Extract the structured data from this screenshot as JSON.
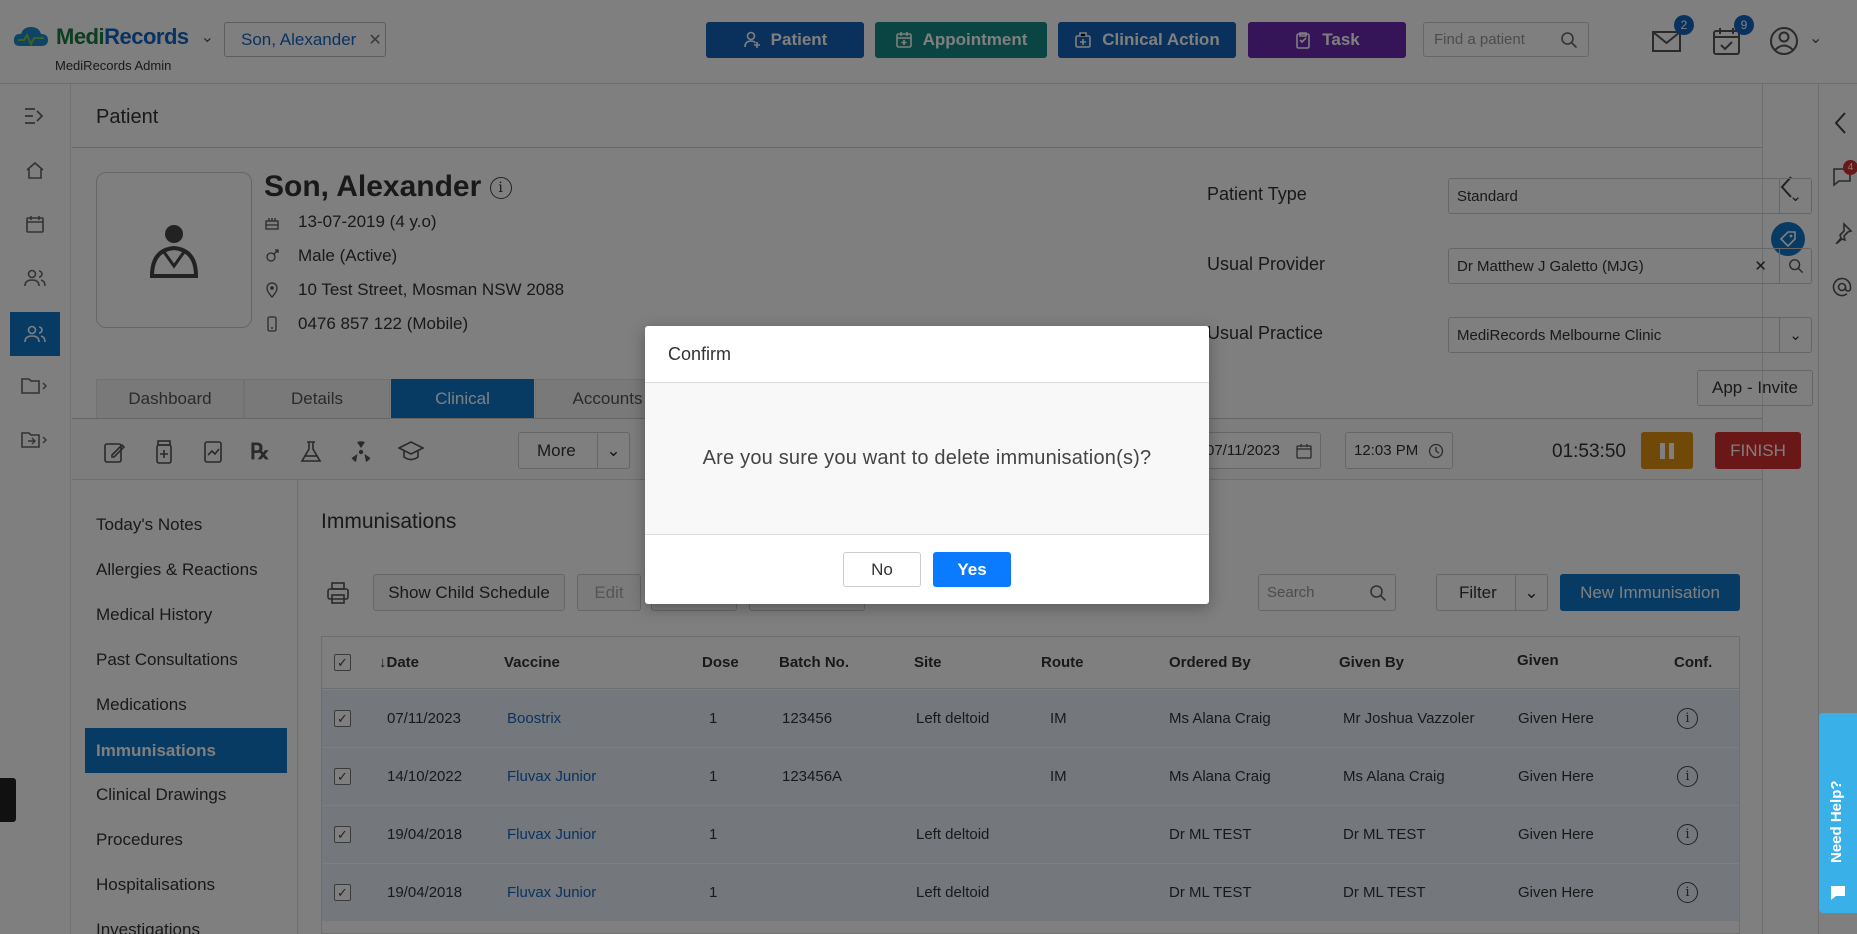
{
  "header": {
    "logo_medi": "Medi",
    "logo_records": "Records",
    "logo_sub": "MediRecords Admin",
    "patient_chip": "Son, Alexander",
    "buttons": {
      "patient": "Patient",
      "appointment": "Appointment",
      "clinical_action": "Clinical Action",
      "task": "Task"
    },
    "find_placeholder": "Find a patient",
    "mail_count": "2",
    "tasks_count": "9"
  },
  "page_title": "Patient",
  "patient": {
    "name": "Son, Alexander",
    "dob": "13-07-2019 (4 y.o)",
    "gender": "Male (Active)",
    "address": "10 Test Street, Mosman NSW 2088",
    "phone": "0476 857 122 (Mobile)",
    "patient_type_label": "Patient Type",
    "patient_type": "Standard",
    "usual_provider_label": "Usual Provider",
    "usual_provider": "Dr Matthew J Galetto (MJG)",
    "usual_practice_label": "Usual Practice",
    "usual_practice": "MediRecords Melbourne Clinic",
    "app_invite": "App - Invite"
  },
  "tabs": [
    "Dashboard",
    "Details",
    "Clinical",
    "Accounts"
  ],
  "toolbar": {
    "more": "More",
    "date": "07/11/2023",
    "time": "12:03 PM",
    "timer": "01:53:50",
    "finish": "FINISH"
  },
  "sidemenu": [
    "Today's Notes",
    "Allergies & Reactions",
    "Medical History",
    "Past Consultations",
    "Medications",
    "Immunisations",
    "Clinical Drawings",
    "Procedures",
    "Hospitalisations",
    "Investigations"
  ],
  "main": {
    "title": "Immunisations",
    "show_child_schedule": "Show Child Schedule",
    "edit": "Edit",
    "search_placeholder": "Search",
    "filter": "Filter",
    "new_immunisation": "New Immunisation",
    "columns": [
      "Date",
      "Vaccine",
      "Dose",
      "Batch No.",
      "Site",
      "Route",
      "Ordered By",
      "Given By",
      "Given",
      "Conf."
    ],
    "rows": [
      {
        "date": "07/11/2023",
        "vaccine": "Boostrix",
        "dose": "1",
        "batch": "123456",
        "site": "Left deltoid",
        "route": "IM",
        "ordered_by": "Ms Alana Craig",
        "given_by": "Mr Joshua Vazzoler",
        "given": "Given Here"
      },
      {
        "date": "14/10/2022",
        "vaccine": "Fluvax Junior",
        "dose": "1",
        "batch": "123456A",
        "site": "",
        "route": "IM",
        "ordered_by": "Ms Alana Craig",
        "given_by": "Ms Alana Craig",
        "given": "Given Here"
      },
      {
        "date": "19/04/2018",
        "vaccine": "Fluvax Junior",
        "dose": "1",
        "batch": "",
        "site": "Left deltoid",
        "route": "",
        "ordered_by": "Dr ML TEST",
        "given_by": "Dr ML TEST",
        "given": "Given Here"
      },
      {
        "date": "19/04/2018",
        "vaccine": "Fluvax Junior",
        "dose": "1",
        "batch": "",
        "site": "Left deltoid",
        "route": "",
        "ordered_by": "Dr ML TEST",
        "given_by": "Dr ML TEST",
        "given": "Given Here"
      }
    ]
  },
  "modal": {
    "title": "Confirm",
    "message": "Are you sure you want to delete immunisation(s)?",
    "no": "No",
    "yes": "Yes"
  },
  "need_help": "Need Help?",
  "chat_badge": "4",
  "colors": {
    "patient_btn": "#1560b8",
    "appointment_btn": "#168b86",
    "clinical_action_btn": "#1560b8",
    "task_btn": "#6a2bb0",
    "primary": "#0f77c8",
    "yes_btn": "#0a7bff",
    "finish": "#d32f2f",
    "pause": "#e09010"
  }
}
